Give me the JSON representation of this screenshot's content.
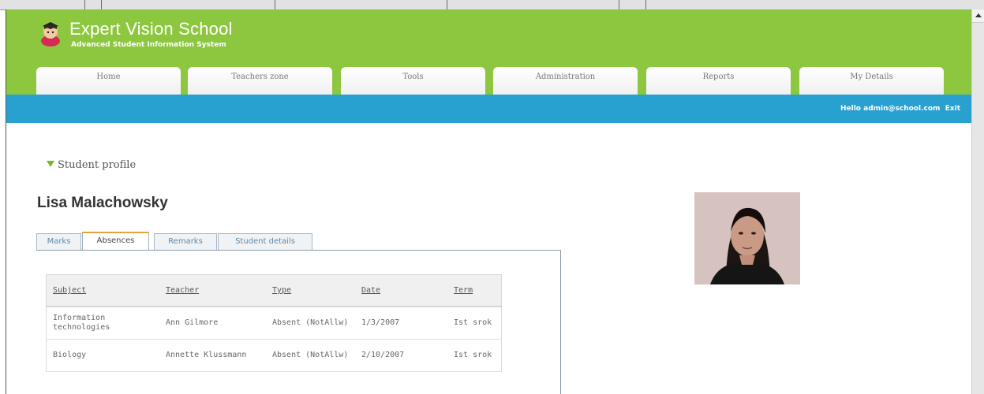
{
  "app": {
    "title": "Expert Vision School",
    "subtitle": "Advanced Student Information System"
  },
  "nav": {
    "tabs": [
      {
        "label": "Home"
      },
      {
        "label": "Teachers zone"
      },
      {
        "label": "Tools"
      },
      {
        "label": "Administration"
      },
      {
        "label": "Reports"
      },
      {
        "label": "My Details"
      }
    ]
  },
  "userbar": {
    "greeting": "Hello admin@school.com",
    "exit": "Exit"
  },
  "profile": {
    "toggle_label": "Student profile",
    "student_name": "Lisa Malachowsky",
    "tabs": [
      {
        "label": "Marks"
      },
      {
        "label": "Absences"
      },
      {
        "label": "Remarks"
      },
      {
        "label": "Student details"
      }
    ],
    "active_tab": "Absences"
  },
  "absences": {
    "headers": [
      "Subject",
      "Teacher",
      "Type",
      "Date",
      "Term"
    ],
    "rows": [
      {
        "subject": "Information technologies",
        "teacher": "Ann Gilmore",
        "type": "Absent (NotAllw)",
        "date": "1/3/2007",
        "term": "Ist srok"
      },
      {
        "subject": "Biology",
        "teacher": "Annette Klussmann",
        "type": "Absent (NotAllw)",
        "date": "2/10/2007",
        "term": "Ist srok"
      }
    ]
  },
  "colors": {
    "header_green": "#8dc63f",
    "userbar_blue": "#28a0d0",
    "active_tab_accent": "#e8a23a"
  },
  "icons": {
    "logo": "student-mascot-icon",
    "toggle": "triangle-down-icon",
    "scroll": "scroll-up-arrow-icon"
  }
}
